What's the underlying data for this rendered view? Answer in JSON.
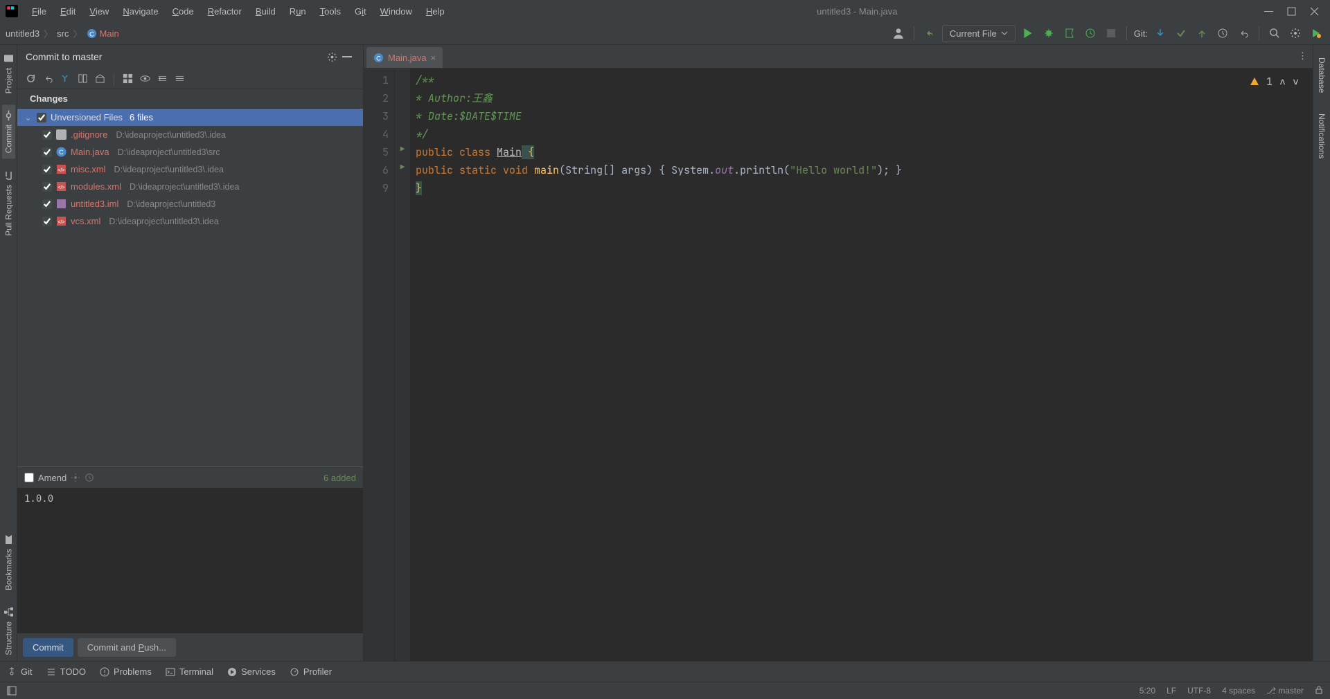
{
  "window": {
    "title": "untitled3 - Main.java"
  },
  "menu": [
    "File",
    "Edit",
    "View",
    "Navigate",
    "Code",
    "Refactor",
    "Build",
    "Run",
    "Tools",
    "Git",
    "Window",
    "Help"
  ],
  "breadcrumb": {
    "items": [
      "untitled3",
      "src"
    ],
    "active": "Main"
  },
  "toolbar": {
    "run_config": "Current File",
    "git_label": "Git:"
  },
  "leftRail": [
    "Project",
    "Commit",
    "Pull Requests",
    "Bookmarks",
    "Structure"
  ],
  "rightRail": [
    "Database",
    "Notifications"
  ],
  "commitPanel": {
    "title": "Commit to master",
    "changes_label": "Changes",
    "unversioned_label": "Unversioned Files",
    "unversioned_count": "6 files",
    "files": [
      {
        "name": ".gitignore",
        "path": "D:\\ideaproject\\untitled3\\.idea",
        "icon": "git"
      },
      {
        "name": "Main.java",
        "path": "D:\\ideaproject\\untitled3\\src",
        "icon": "java"
      },
      {
        "name": "misc.xml",
        "path": "D:\\ideaproject\\untitled3\\.idea",
        "icon": "xml"
      },
      {
        "name": "modules.xml",
        "path": "D:\\ideaproject\\untitled3\\.idea",
        "icon": "xml"
      },
      {
        "name": "untitled3.iml",
        "path": "D:\\ideaproject\\untitled3",
        "icon": "iml"
      },
      {
        "name": "vcs.xml",
        "path": "D:\\ideaproject\\untitled3\\.idea",
        "icon": "xml"
      }
    ],
    "amend": "Amend",
    "added": "6 added",
    "message": "1.0.0",
    "commit_btn": "Commit",
    "push_btn": "Commit and Push..."
  },
  "editor": {
    "tab": "Main.java",
    "lines": [
      "1",
      "2",
      "3",
      "4",
      "5",
      "6",
      "9"
    ],
    "error_count": "1",
    "info_row": {
      "caret": "5:20",
      "eol": "LF",
      "encoding": "UTF-8",
      "indent": "4 spaces",
      "branch": "master"
    }
  },
  "code": {
    "l1": "/**",
    "l2_pre": " * Author:",
    "l2_author": "王鑫",
    "l3": " * Date:$DATE$TIME",
    "l4": " */",
    "l5_public": "public ",
    "l5_class": "class ",
    "l5_name": "Main",
    "l5_brace": " {",
    "l6_pre": "    ",
    "l6_public": "public ",
    "l6_static": "static ",
    "l6_void": "void ",
    "l6_main": "main",
    "l6_args": "(String[] args) { System.",
    "l6_out": "out",
    "l6_print": ".println(",
    "l6_str": "\"Hello world!\"",
    "l6_end": "); }",
    "l7": "}"
  },
  "bottomBar": [
    "Git",
    "TODO",
    "Problems",
    "Terminal",
    "Services",
    "Profiler"
  ]
}
